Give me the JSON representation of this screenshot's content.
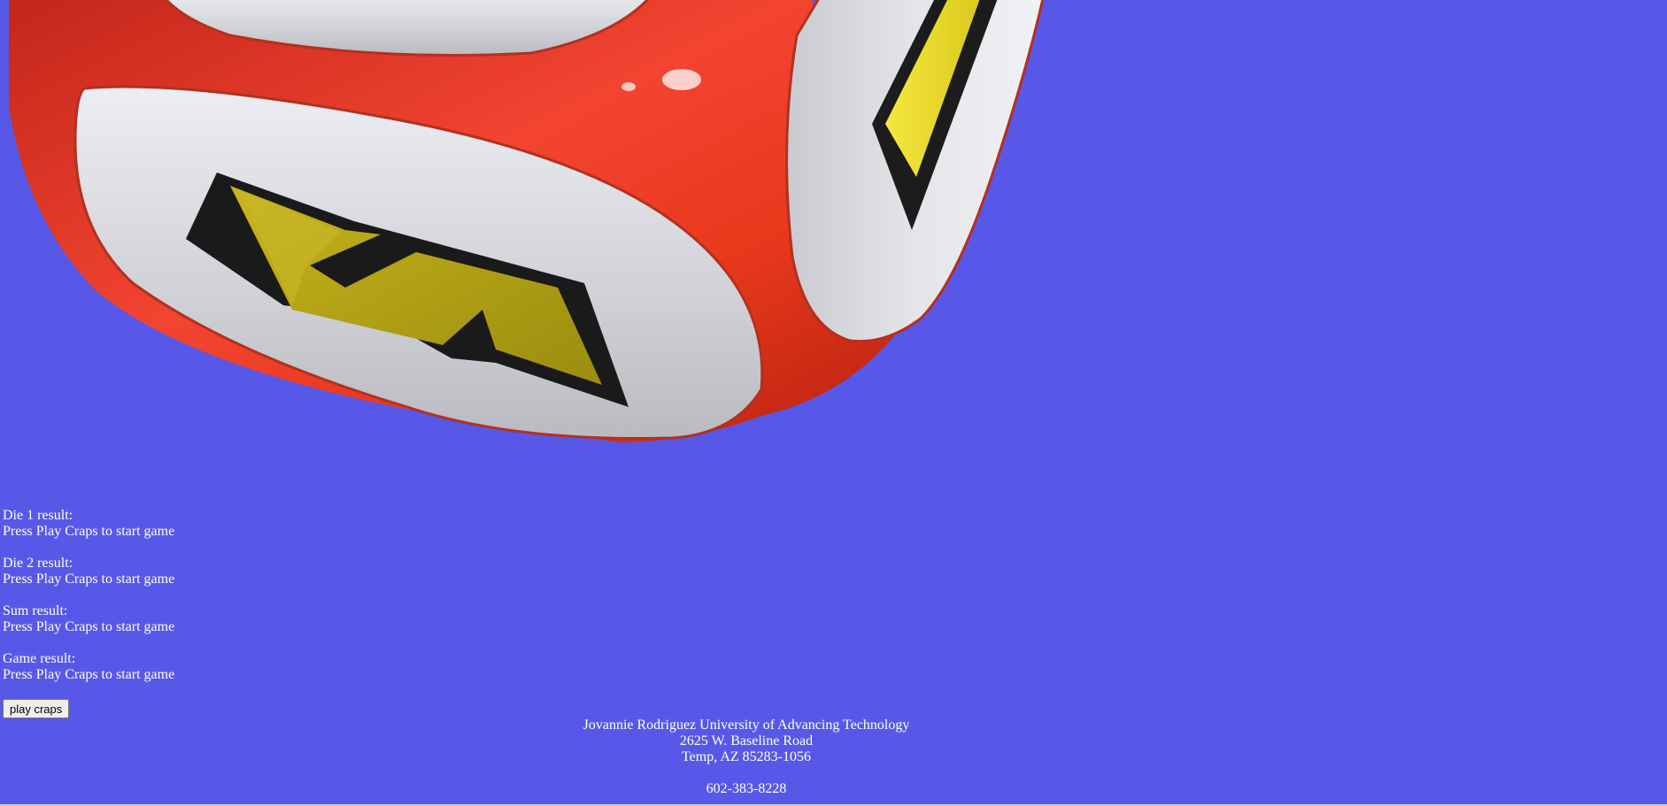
{
  "colors": {
    "background": "#5858e8",
    "die_body": "#e8391c",
    "die_face": "#d9dadf",
    "pip": "#d6c21a"
  },
  "hero": {
    "icon": "die-icon"
  },
  "results": [
    {
      "label": "Die 1 result:",
      "value": "Press Play Craps to start game"
    },
    {
      "label": "Die 2 result:",
      "value": "Press Play Craps to start game"
    },
    {
      "label": "Sum result:",
      "value": "Press Play Craps to start game"
    },
    {
      "label": "Game result:",
      "value": "Press Play Craps to start game"
    }
  ],
  "controls": {
    "play_label": "play craps"
  },
  "footer": {
    "line1": "Jovannie Rodriguez University of Advancing Technology",
    "line2": "2625 W. Baseline Road",
    "line3": "Temp, AZ 85283-1056",
    "phone": "602-383-8228"
  }
}
